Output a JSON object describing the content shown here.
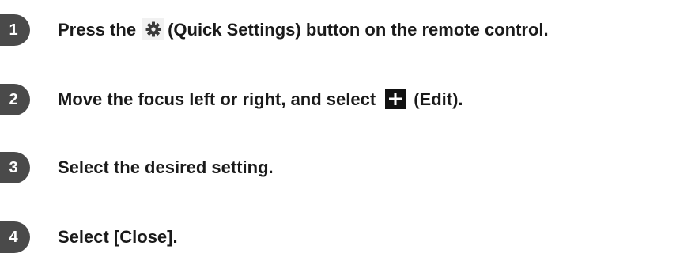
{
  "steps": [
    {
      "number": "1",
      "text_before_icon": "Press the",
      "icon": "quick-settings-gear-icon",
      "text_after_icon": "(Quick Settings) button on the remote control."
    },
    {
      "number": "2",
      "text_before_icon": "Move the focus left or right, and select",
      "icon": "edit-plus-icon",
      "text_after_icon": "(Edit)."
    },
    {
      "number": "3",
      "text": "Select the desired setting."
    },
    {
      "number": "4",
      "text": "Select [Close]."
    }
  ],
  "colors": {
    "badge_background": "#4a4a4a",
    "badge_text": "#ffffff",
    "body_text": "#1a1a1a",
    "gear_icon_fill": "#3a3a3a",
    "gear_icon_background": "#f1f1f1",
    "edit_icon_background": "#111111",
    "edit_icon_plus": "#ffffff"
  }
}
